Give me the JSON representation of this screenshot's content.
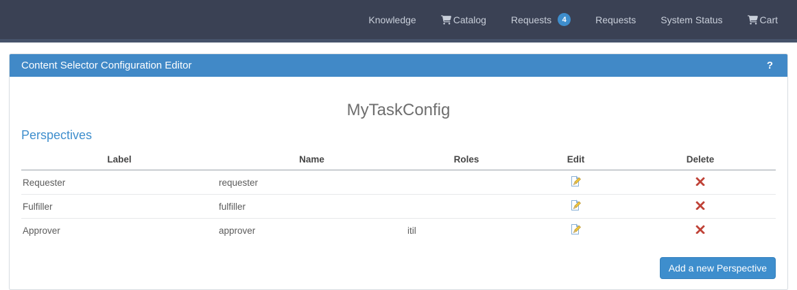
{
  "nav": {
    "items": [
      {
        "label": "Knowledge"
      },
      {
        "label": "Catalog",
        "icon": "cart-icon"
      },
      {
        "label": "Requests",
        "badge": "4"
      },
      {
        "label": "Requests"
      },
      {
        "label": "System Status"
      },
      {
        "label": "Cart",
        "icon": "cart-icon"
      }
    ]
  },
  "panel": {
    "header": {
      "title": "Content Selector Configuration Editor",
      "help_label": "?"
    },
    "config_title": "MyTaskConfig",
    "section_title": "Perspectives",
    "table": {
      "columns": [
        "Label",
        "Name",
        "Roles",
        "Edit",
        "Delete"
      ],
      "rows": [
        {
          "label": "Requester",
          "name": "requester",
          "roles": ""
        },
        {
          "label": "Fulfiller",
          "name": "fulfiller",
          "roles": ""
        },
        {
          "label": "Approver",
          "name": "approver",
          "roles": "itil"
        }
      ],
      "row_icons": {
        "edit": "edit-document-pencil-icon",
        "delete": "delete-x-icon"
      }
    },
    "add_button_label": "Add a new Perspective"
  },
  "colors": {
    "nav_bg": "#3a4154",
    "nav_strip": "#46536a",
    "nav_text": "#c9cfda",
    "header_blue": "#4189c7",
    "accent_blue": "#3e8ecd",
    "delete_red": "#bf4136",
    "title_gray": "#6e6e6e"
  }
}
